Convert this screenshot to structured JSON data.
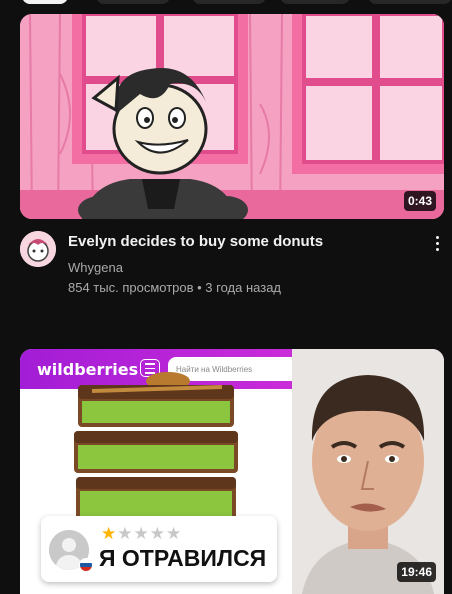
{
  "videos": [
    {
      "title": "Evelyn decides to buy some donuts",
      "channel": "Whygena",
      "stats": "854 тыс. просмотров • 3 года назад",
      "duration": "0:43"
    },
    {
      "duration": "19:46",
      "thumbnail": {
        "brand": "wildberries",
        "search_placeholder": "Найти на Wildberries",
        "review_text": "Я ОТРАВИЛСЯ",
        "rating": 1,
        "rating_max": 5
      }
    }
  ],
  "colors": {
    "background": "#0f0f0f",
    "text_primary": "#f1f1f1",
    "text_secondary": "#aaaaaa",
    "wb_purple": "#a21dd6"
  }
}
